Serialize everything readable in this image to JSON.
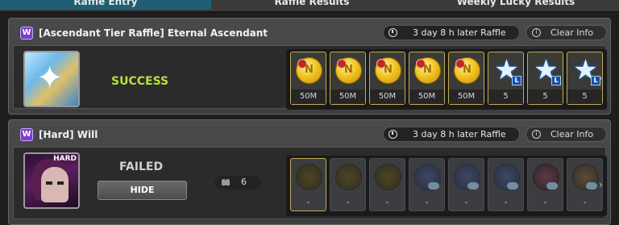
{
  "tabs": [
    {
      "label": "Raffle Entry",
      "active": true
    },
    {
      "label": "Raffle Results",
      "active": false
    },
    {
      "label": "Weekly Lucky Results",
      "active": false
    }
  ],
  "entries": [
    {
      "badge": "W",
      "title": "[Ascendant Tier Raffle] Eternal Ascendant",
      "timer": "3 day 8 h later Raffle",
      "clear_label": "Clear Info",
      "status": "SUCCESS",
      "rewards": [
        "50M",
        "50M",
        "50M",
        "50M",
        "50M",
        "5",
        "5",
        "5"
      ]
    },
    {
      "badge": "W",
      "title": "[Hard] Will",
      "timer": "3 day 8 h later Raffle",
      "clear_label": "Clear Info",
      "boss_tag": "HARD",
      "status": "FAILED",
      "hide_label": "HIDE",
      "party_count": "6",
      "rewards": [
        "-",
        "-",
        "-",
        "-",
        "-",
        "-",
        "-",
        "-"
      ]
    }
  ],
  "colors": {
    "accent_tab": "#1f5f73",
    "success": "#b7e03a",
    "badge": "#7a3fc8"
  }
}
